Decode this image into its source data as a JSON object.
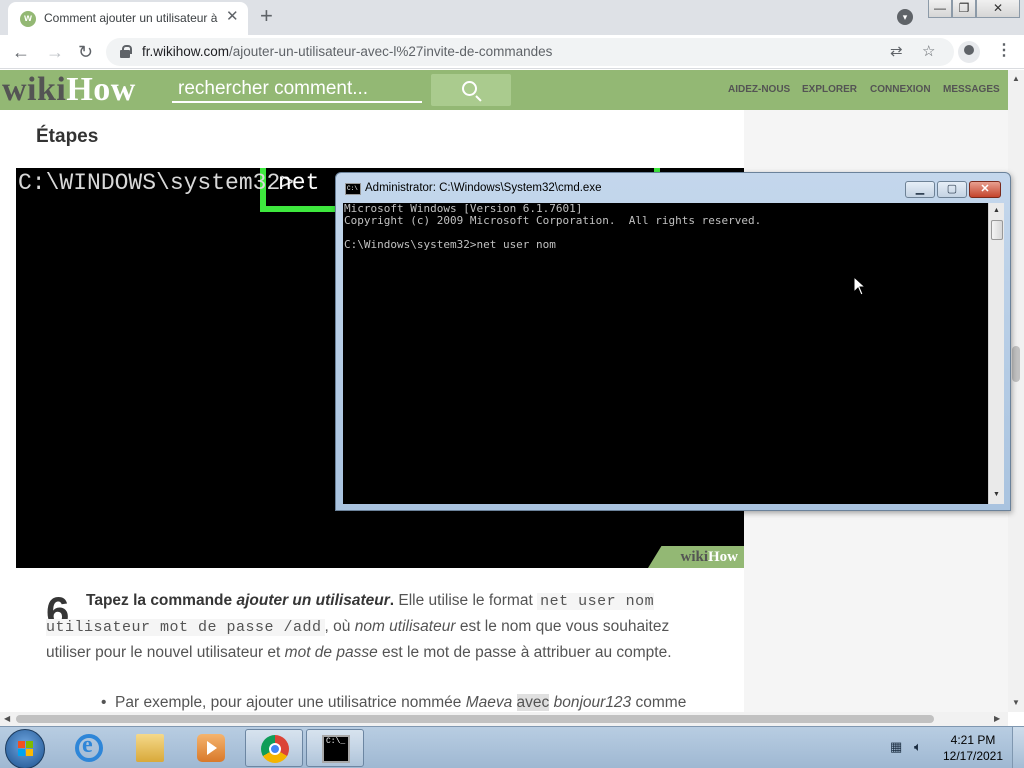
{
  "browser": {
    "tab": {
      "favicon_text": "w",
      "title": "Comment ajouter un utilisateur à",
      "close": "✕"
    },
    "new_tab": "+",
    "url_host": "fr.wikihow.com",
    "url_path": "/ajouter-un-utilisateur-avec-l%27invite-de-commandes",
    "window_controls": [
      "—",
      "❐",
      "✕"
    ]
  },
  "site": {
    "logo_wiki": "wiki",
    "logo_how": "How",
    "search_placeholder": "rechercher comment...",
    "nav": [
      "AIDEZ-NOUS",
      "EXPLORER",
      "CONNEXION",
      "MESSAGES"
    ]
  },
  "article": {
    "section_title": "Étapes",
    "image": {
      "prompt": "C:\\WINDOWS\\system32>",
      "command": "net u",
      "watermark_wiki": "wiki",
      "watermark_how": "How"
    },
    "step": {
      "number": "6",
      "lead": "Tapez la commande ",
      "lead_em": "ajouter un utilisateur",
      "lead_end": ".",
      "t1": " Elle utilise le format ",
      "code": "net user nom utilisateur mot de passe /add",
      "t2": ", où ",
      "em1": "nom utilisateur",
      "t3": " est le nom que vous souhaitez utiliser pour le nouvel utilisateur et ",
      "em2": "mot de passe",
      "t4": " est le mot de passe à attribuer au compte."
    },
    "bullet": {
      "a": "Par exemple, pour ajouter une utilisatrice nommée ",
      "em1": "Maeva",
      "sel": "avec",
      "em2": "bonjour123",
      "b": " comme"
    }
  },
  "cmd_window": {
    "title": "Administrator: C:\\Windows\\System32\\cmd.exe",
    "icon_text": "C:\\",
    "lines": [
      "Microsoft Windows [Version 6.1.7601]",
      "Copyright (c) 2009 Microsoft Corporation.  All rights reserved.",
      "",
      "C:\\Windows\\system32>net user nom"
    ]
  },
  "taskbar": {
    "items": [
      {
        "name": "internet-explorer"
      },
      {
        "name": "windows-explorer"
      },
      {
        "name": "windows-media-player"
      },
      {
        "name": "google-chrome"
      },
      {
        "name": "command-prompt"
      }
    ],
    "cmd_icon_text": "C:\\_",
    "time": "4:21 PM",
    "date": "12/17/2021"
  }
}
